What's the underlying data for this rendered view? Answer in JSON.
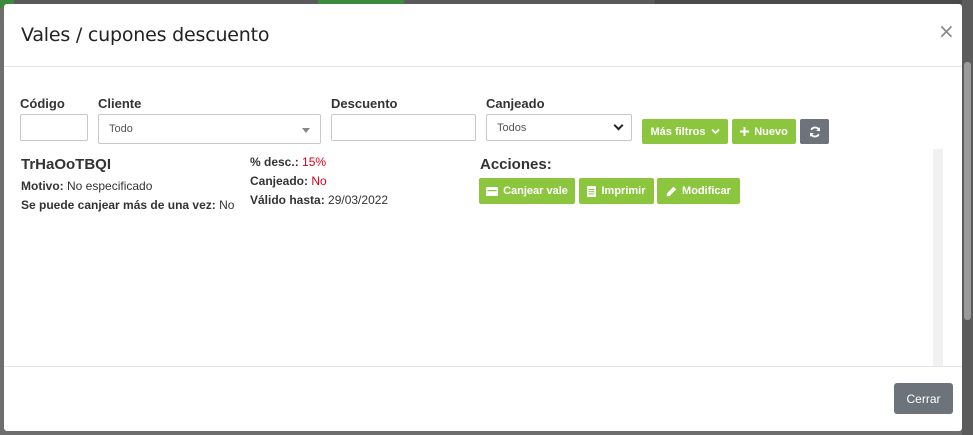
{
  "modal": {
    "title": "Vales / cupones descuento",
    "close_symbol": "×"
  },
  "filters": {
    "codigo_label": "Código",
    "codigo_value": "",
    "cliente_label": "Cliente",
    "cliente_value": "Todo",
    "descuento_label": "Descuento",
    "descuento_value": "",
    "canjeado_label": "Canjeado",
    "canjeado_value": "Todos",
    "mas_filtros_label": "Más filtros",
    "nuevo_label": "Nuevo"
  },
  "voucher": {
    "code": "TrHaOoTBQI",
    "motivo_label": "Motivo:",
    "motivo_value": "No especificado",
    "multi_label": "Se puede canjear más de una vez:",
    "multi_value": "No",
    "desc_label": "% desc.:",
    "desc_value": "15%",
    "canjeado_label": "Canjeado:",
    "canjeado_value": "No",
    "valido_label": "Válido hasta:",
    "valido_value": "29/03/2022"
  },
  "actions": {
    "title": "Acciones:",
    "canjear_label": "Canjear vale",
    "imprimir_label": "Imprimir",
    "modificar_label": "Modificar"
  },
  "footer": {
    "cerrar_label": "Cerrar"
  },
  "colors": {
    "accent_green": "#8cc63f",
    "button_gray": "#6c737a",
    "alert_red": "#d9001b"
  }
}
